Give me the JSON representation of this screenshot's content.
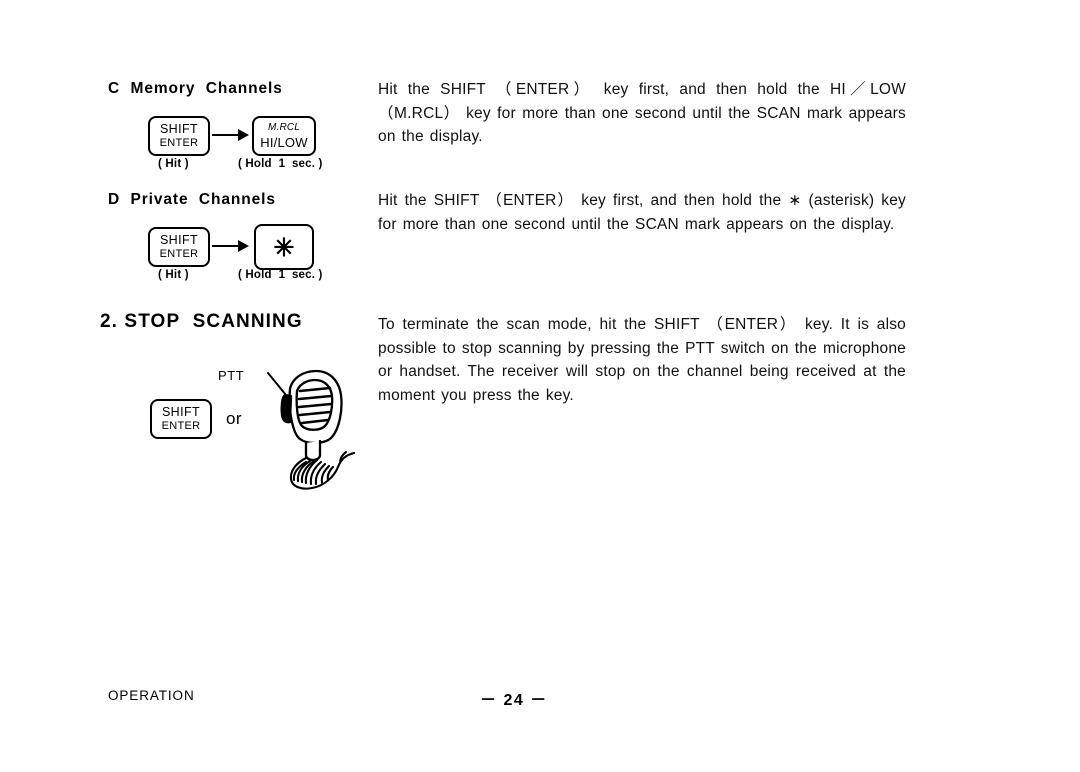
{
  "page": {
    "footer_section": "OPERATION",
    "page_number": "－ 24 －"
  },
  "sections": [
    {
      "id": "memory-channels",
      "heading": "C  Memory  Channels",
      "body": "Hit the SHIFT （ENTER） key first, and then hold the HI／LOW （M.RCL） key for more than one second until the SCAN mark appears on the display.",
      "diagram": {
        "key1": {
          "top": "SHIFT",
          "bottom": "ENTER",
          "caption": "( Hit )"
        },
        "arrow": "arrow-right",
        "key2": {
          "top": "M.RCL",
          "bottom": "HI/LOW",
          "caption": "( Hold  1  sec. )"
        }
      }
    },
    {
      "id": "private-channels",
      "heading": "D  Private  Channels",
      "body": "Hit the SHIFT （ENTER） key first, and then hold the ∗ (asterisk) key for more than one second until the SCAN mark appears on the display.",
      "diagram": {
        "key1": {
          "top": "SHIFT",
          "bottom": "ENTER",
          "caption": "( Hit )"
        },
        "arrow": "arrow-right",
        "key2": {
          "glyph": "✳",
          "caption": "( Hold  1  sec. )"
        }
      }
    },
    {
      "id": "stop-scanning",
      "heading": "2. STOP  SCANNING",
      "body": "To terminate the scan mode, hit the SHIFT （ENTER） key. It is also possible to stop scanning by pressing the PTT switch on the microphone or handset. The receiver will stop on the channel being received at the moment you press the key.",
      "diagram": {
        "key1": {
          "top": "SHIFT",
          "bottom": "ENTER"
        },
        "conjunction": "or",
        "mic_label": "PTT"
      }
    }
  ]
}
